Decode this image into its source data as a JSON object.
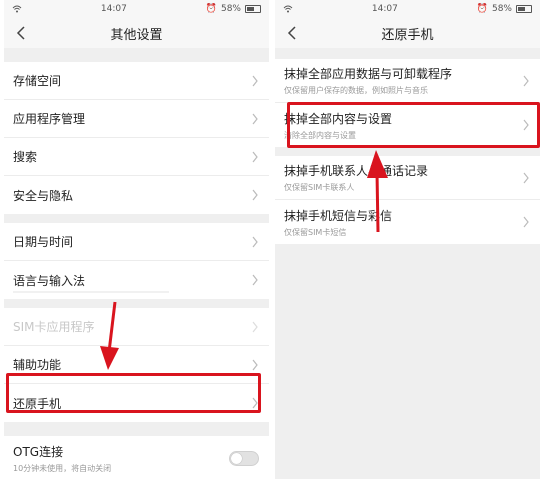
{
  "left": {
    "status": {
      "time": "14:07",
      "battery": "58%"
    },
    "title": "其他设置",
    "groups": [
      {
        "items": [
          {
            "label": "存储空间"
          },
          {
            "label": "应用程序管理"
          },
          {
            "label": "搜索"
          },
          {
            "label": "安全与隐私"
          }
        ]
      },
      {
        "items": [
          {
            "label": "日期与时间"
          },
          {
            "label": "语言与输入法"
          }
        ]
      },
      {
        "items": [
          {
            "label": "SIM卡应用程序"
          },
          {
            "label": "辅助功能"
          },
          {
            "label": "还原手机"
          }
        ]
      },
      {
        "items": [
          {
            "label": "OTG连接",
            "sub": "10分钟未使用，将自动关闭"
          }
        ]
      }
    ]
  },
  "right": {
    "status": {
      "time": "14:07",
      "battery": "58%"
    },
    "title": "还原手机",
    "items": [
      {
        "label": "抹掉全部应用数据与可卸载程序",
        "sub": "仅保留用户保存的数据，例如照片与音乐"
      },
      {
        "label": "抹掉全部内容与设置",
        "sub": "清除全部内容与设置"
      },
      {
        "label": "抹掉手机联系人与通话记录",
        "sub": "仅保留SIM卡联系人"
      },
      {
        "label": "抹掉手机短信与彩信",
        "sub": "仅保留SIM卡短信"
      }
    ]
  },
  "colors": {
    "highlight": "#d9141e",
    "background": "#efefef"
  }
}
